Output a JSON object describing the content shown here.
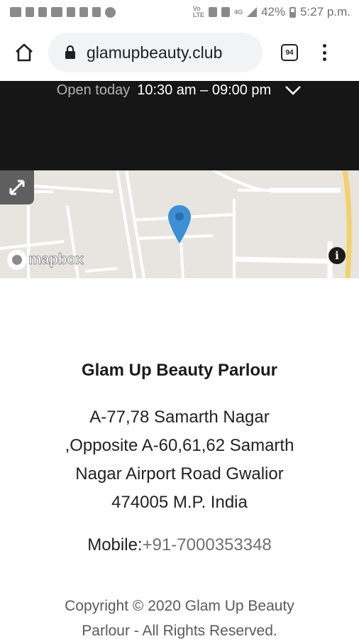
{
  "status_bar": {
    "battery_percent": "42%",
    "time": "5:27 p.m."
  },
  "browser": {
    "url": "glamupbeauty.club",
    "tab_count": "94"
  },
  "hours": {
    "label": "Open today",
    "value": "10:30 am – 09:00 pm"
  },
  "map": {
    "attribution": "mapbox",
    "info_label": "i"
  },
  "business": {
    "name": "Glam Up Beauty Parlour",
    "address_lines": [
      "A-77,78 Samarth Nagar",
      ",Opposite A-60,61,62 Samarth",
      "Nagar Airport Road Gwalior",
      "474005 M.P. India"
    ],
    "mobile_label": "Mobile:",
    "mobile_number": "+91-7000353348"
  },
  "footer": {
    "copyright_lines": [
      "Copyright © 2020 Glam Up Beauty",
      "Parlour - All Rights Reserved."
    ]
  }
}
